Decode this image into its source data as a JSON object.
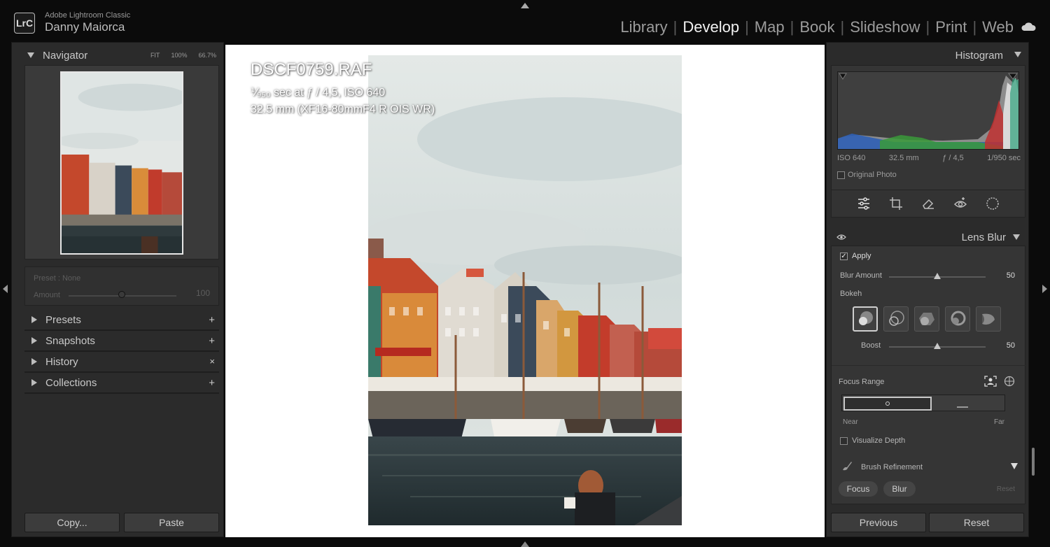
{
  "app": {
    "logo": "LrC",
    "name": "Adobe Lightroom Classic",
    "user": "Danny Maiorca"
  },
  "modules": [
    "Library",
    "Develop",
    "Map",
    "Book",
    "Slideshow",
    "Print",
    "Web"
  ],
  "active_module": "Develop",
  "navigator": {
    "title": "Navigator",
    "zoom_options": [
      "FIT",
      "100%",
      "66.7%"
    ]
  },
  "preset_amount": {
    "preset_label": "Preset : None",
    "amount_label": "Amount",
    "amount_value": "100"
  },
  "left_sections": [
    {
      "label": "Presets",
      "action": "+"
    },
    {
      "label": "Snapshots",
      "action": "+"
    },
    {
      "label": "History",
      "action": "×"
    },
    {
      "label": "Collections",
      "action": "+"
    }
  ],
  "left_buttons": {
    "copy": "Copy...",
    "paste": "Paste"
  },
  "photo_info": {
    "filename": "DSCF0759.RAF",
    "exposure": "⅟₉₅₀ sec at ƒ / 4,5, ISO 640",
    "lens": "32.5 mm (XF16-80mmF4 R OIS WR)"
  },
  "histogram": {
    "title": "Histogram",
    "iso": "ISO 640",
    "focal": "32.5 mm",
    "aperture": "ƒ / 4,5",
    "shutter": "1/950 sec",
    "original_photo_label": "Original Photo"
  },
  "lens_blur": {
    "title": "Lens Blur",
    "apply_label": "Apply",
    "blur_amount_label": "Blur Amount",
    "blur_amount_value": "50",
    "bokeh_label": "Bokeh",
    "boost_label": "Boost",
    "boost_value": "50",
    "focus_range_label": "Focus Range",
    "near_label": "Near",
    "far_label": "Far",
    "visualize_depth_label": "Visualize Depth",
    "brush_refinement_label": "Brush Refinement",
    "focus_btn": "Focus",
    "blur_btn": "Blur",
    "reset_small": "Reset"
  },
  "right_buttons": {
    "previous": "Previous",
    "reset": "Reset"
  },
  "colors": {
    "active_text": "#f2f2f2",
    "panel_bg": "#2b2b2b",
    "canvas_bg": "#ffffff"
  }
}
